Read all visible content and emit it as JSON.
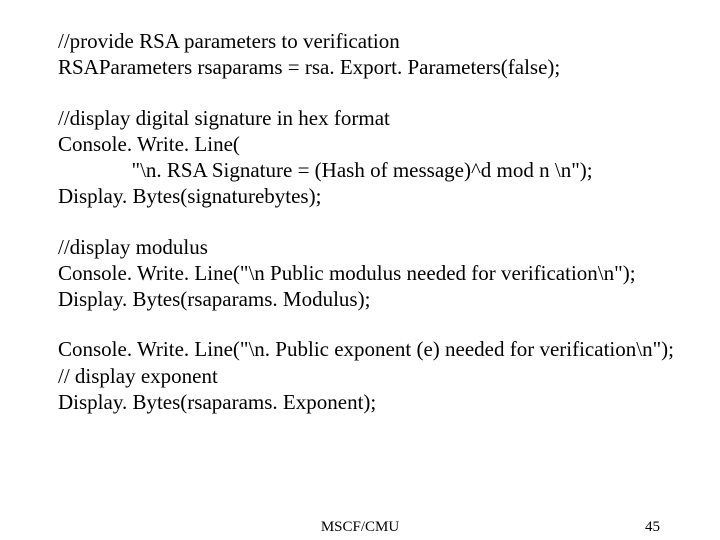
{
  "lines": {
    "l1": "//provide RSA parameters to verification",
    "l2": "RSAParameters rsaparams = rsa. Export. Parameters(false);",
    "l3": "//display digital signature in hex format",
    "l4": "Console. Write. Line(",
    "l5": "              \"\\n. RSA Signature = (Hash of message)^d mod n \\n\");",
    "l6": "Display. Bytes(signaturebytes);",
    "l7": "//display modulus",
    "l8": "Console. Write. Line(\"\\n Public modulus needed for verification\\n\");",
    "l9": "Display. Bytes(rsaparams. Modulus);",
    "l10": "Console. Write. Line(\"\\n. Public exponent (e) needed for verification\\n\");",
    "l11": "// display exponent",
    "l12": "Display. Bytes(rsaparams. Exponent);"
  },
  "footer": {
    "center": "MSCF/CMU",
    "right": "45"
  }
}
